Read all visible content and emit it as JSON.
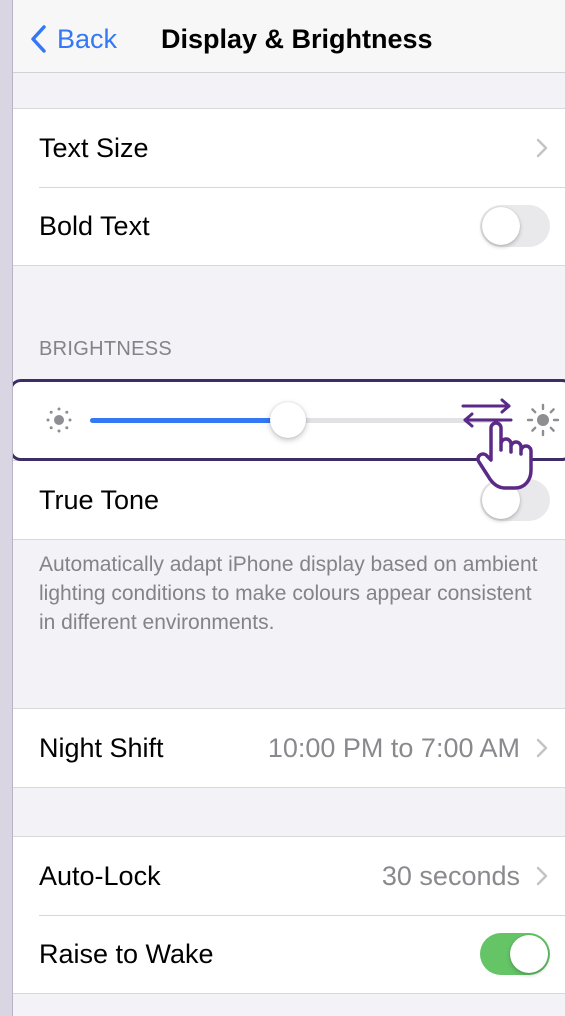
{
  "nav": {
    "back_label": "Back",
    "title": "Display & Brightness"
  },
  "text_group": {
    "text_size_label": "Text Size",
    "bold_text_label": "Bold Text",
    "bold_text_on": false
  },
  "brightness": {
    "section_header": "BRIGHTNESS",
    "level_fraction": 0.48,
    "true_tone_label": "True Tone",
    "true_tone_on": false,
    "footer": "Automatically adapt iPhone display based on ambient lighting conditions to make colours appear consistent in different environments."
  },
  "night_shift": {
    "label": "Night Shift",
    "value": "10:00 PM to 7:00 AM"
  },
  "lock_group": {
    "auto_lock_label": "Auto-Lock",
    "auto_lock_value": "30 seconds",
    "raise_to_wake_label": "Raise to Wake",
    "raise_to_wake_on": true
  },
  "colors": {
    "accent": "#3478f6",
    "toggle_on": "#64c466",
    "toggle_off": "#e9e9eb",
    "highlight": "#3e2c66",
    "annotation": "#5b2a86"
  },
  "icons": [
    "back-chevron-icon",
    "chevron-right-icon",
    "sun-small-icon",
    "sun-large-icon",
    "swap-arrows-icon",
    "hand-cursor-icon"
  ]
}
